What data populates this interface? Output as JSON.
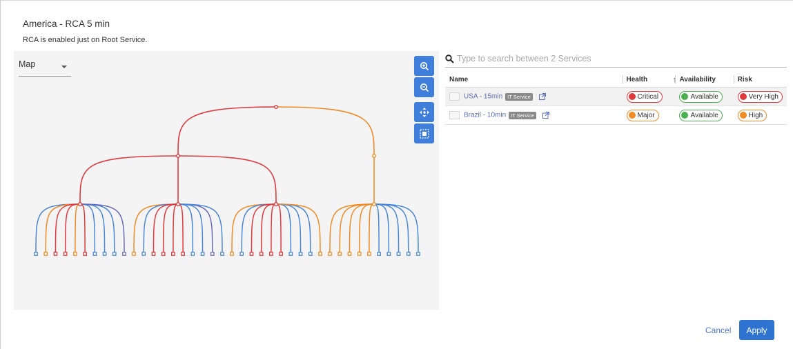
{
  "dialog": {
    "title": "America - RCA 5 min",
    "subtitle": "RCA is enabled just on Root Service."
  },
  "map": {
    "view_select": {
      "value": "Map"
    },
    "toolbar": [
      {
        "name": "zoom-in",
        "icon": "zoom-in-icon"
      },
      {
        "name": "zoom-out",
        "icon": "zoom-out-icon"
      },
      {
        "name": "pan",
        "icon": "move-icon"
      },
      {
        "name": "fit",
        "icon": "fit-to-screen-icon"
      }
    ],
    "colors": {
      "critical": "#e0393e",
      "major": "#f08a24",
      "normal": "#4a86d8",
      "mixed": "#6a6ab8"
    }
  },
  "search": {
    "placeholder": "Type to search between 2 Services",
    "icon": "search-icon"
  },
  "table": {
    "columns": [
      "Name",
      "Health",
      "Availability",
      "Risk"
    ],
    "sort": {
      "column": "Health",
      "direction": "ascending"
    },
    "rows": [
      {
        "name": "USA - 15min",
        "type": "IT Service",
        "health": "Critical",
        "availability": "Available",
        "risk": "Very High",
        "health_color": "#e0393e",
        "availability_color": "#4caf50",
        "risk_color": "#e0393e"
      },
      {
        "name": "Brazil - 10min",
        "type": "IT Service",
        "health": "Major",
        "availability": "Available",
        "risk": "High",
        "health_color": "#f08a24",
        "availability_color": "#4caf50",
        "risk_color": "#f08a24"
      }
    ]
  },
  "footer": {
    "cancel_label": "Cancel",
    "apply_label": "Apply"
  }
}
